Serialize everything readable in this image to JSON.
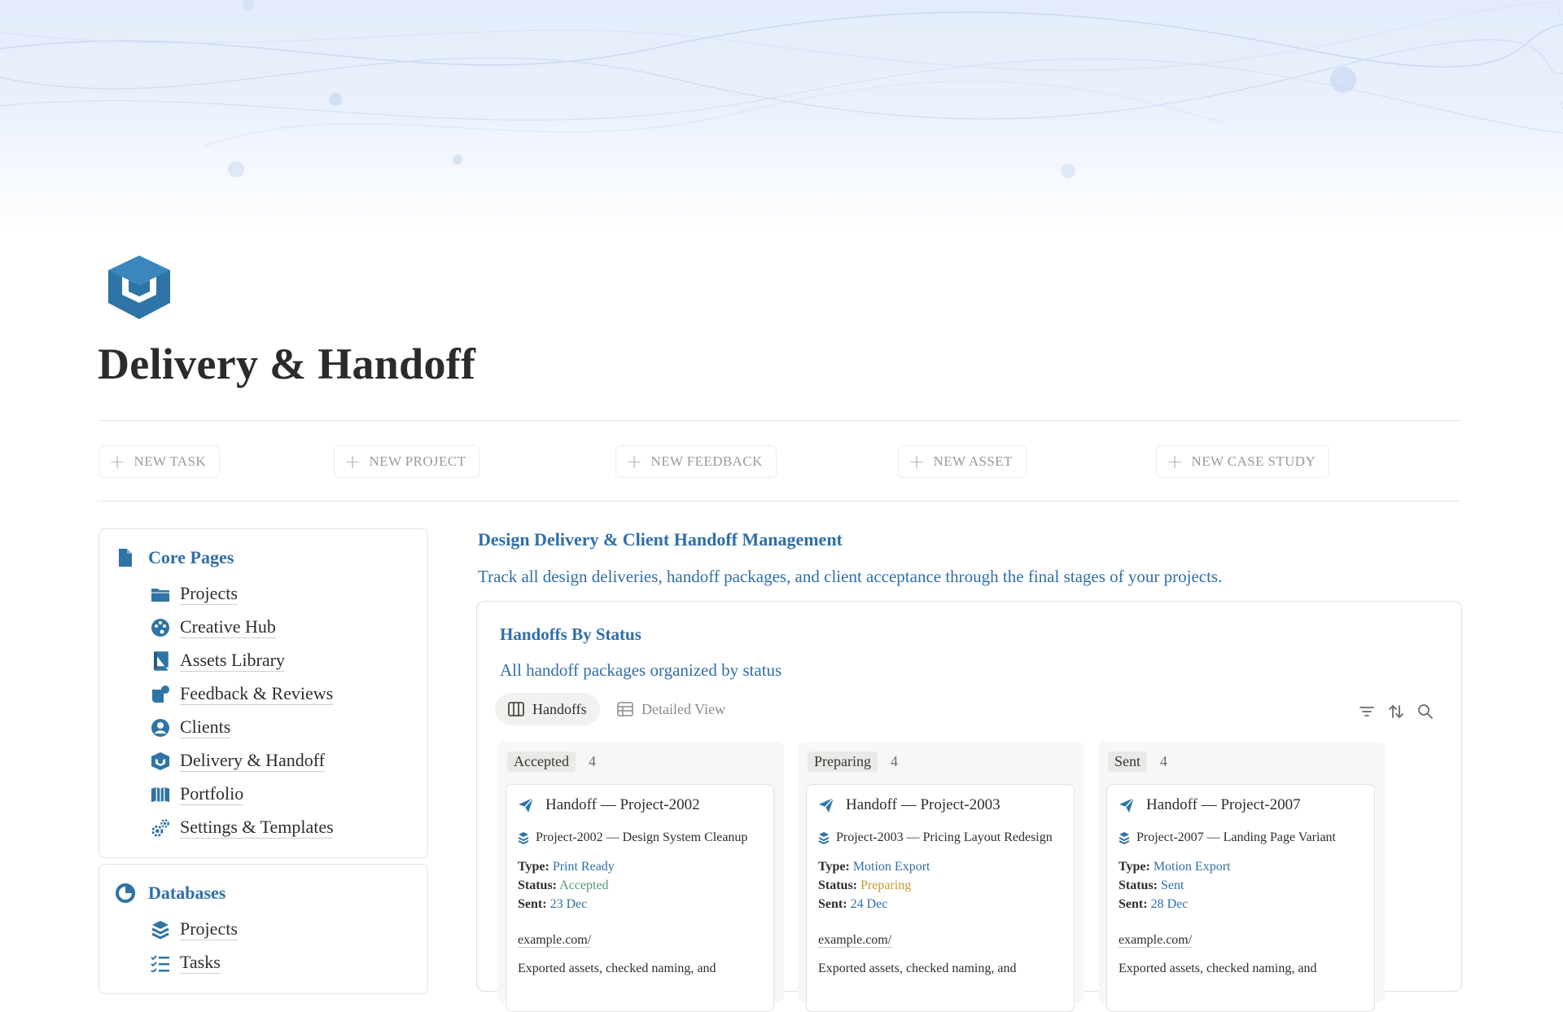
{
  "page": {
    "title": "Delivery & Handoff",
    "icon": "delivery-box-icon"
  },
  "quick_actions": [
    {
      "label": "NEW TASK",
      "icon": "plus-icon"
    },
    {
      "label": "NEW PROJECT",
      "icon": "plus-icon"
    },
    {
      "label": "NEW FEEDBACK",
      "icon": "plus-icon"
    },
    {
      "label": "NEW ASSET",
      "icon": "plus-icon"
    },
    {
      "label": "NEW CASE STUDY",
      "icon": "plus-icon"
    }
  ],
  "core_pages": {
    "heading": "Core Pages",
    "icon": "document-icon",
    "items": [
      {
        "label": "Projects",
        "icon": "folder-icon"
      },
      {
        "label": "Creative Hub",
        "icon": "palette-icon"
      },
      {
        "label": "Assets Library",
        "icon": "book-icon"
      },
      {
        "label": "Feedback & Reviews",
        "icon": "chat-bubble-icon"
      },
      {
        "label": "Clients",
        "icon": "person-circle-icon"
      },
      {
        "label": "Delivery & Handoff",
        "icon": "delivery-box-icon"
      },
      {
        "label": "Portfolio",
        "icon": "open-book-icon"
      },
      {
        "label": "Settings & Templates",
        "icon": "gears-icon"
      }
    ]
  },
  "databases": {
    "heading": "Databases",
    "icon": "pie-chart-icon",
    "items": [
      {
        "label": "Projects",
        "icon": "layers-icon"
      },
      {
        "label": "Tasks",
        "icon": "checklist-icon"
      }
    ]
  },
  "main": {
    "title": "Design Delivery & Client Handoff Management",
    "description": "Track all design deliveries, handoff packages, and client acceptance through the final stages of your projects."
  },
  "database": {
    "title": "Handoffs By Status",
    "description": "All handoff packages organized by status",
    "views": [
      {
        "label": "Handoffs",
        "icon": "board-icon",
        "active": true
      },
      {
        "label": "Detailed View",
        "icon": "table-icon",
        "active": false
      }
    ],
    "tools": [
      "filter-icon",
      "sort-icon",
      "search-icon"
    ],
    "columns": [
      {
        "name": "Accepted",
        "count": "4",
        "card": {
          "title": "Handoff — Project-2002",
          "project": "Project-2002 — Design System Cleanup",
          "type_label": "Type:",
          "type": "Print Ready",
          "status_label": "Status:",
          "status": "Accepted",
          "sent_label": "Sent:",
          "sent": "23 Dec",
          "link": "example.com/",
          "notes": "Exported assets, checked naming, and"
        }
      },
      {
        "name": "Preparing",
        "count": "4",
        "card": {
          "title": "Handoff — Project-2003",
          "project": "Project-2003 — Pricing Layout Redesign",
          "type_label": "Type:",
          "type": "Motion Export",
          "status_label": "Status:",
          "status": "Preparing",
          "sent_label": "Sent:",
          "sent": "24 Dec",
          "link": "example.com/",
          "notes": "Exported assets, checked naming, and"
        }
      },
      {
        "name": "Sent",
        "count": "4",
        "card": {
          "title": "Handoff — Project-2007",
          "project": "Project-2007 — Landing Page Variant",
          "type_label": "Type:",
          "type": "Motion Export",
          "status_label": "Status:",
          "status": "Sent",
          "sent_label": "Sent:",
          "sent": "28 Dec",
          "link": "example.com/",
          "notes": "Exported assets, checked naming, and"
        }
      }
    ]
  },
  "colors": {
    "accent": "#2f6fa8",
    "icon_blue": "#2e74a6",
    "status_accepted": "#4e9a6a",
    "status_preparing": "#c59a2e",
    "status_sent": "#2f6fa8",
    "value_blue": "#2f6fa8"
  }
}
